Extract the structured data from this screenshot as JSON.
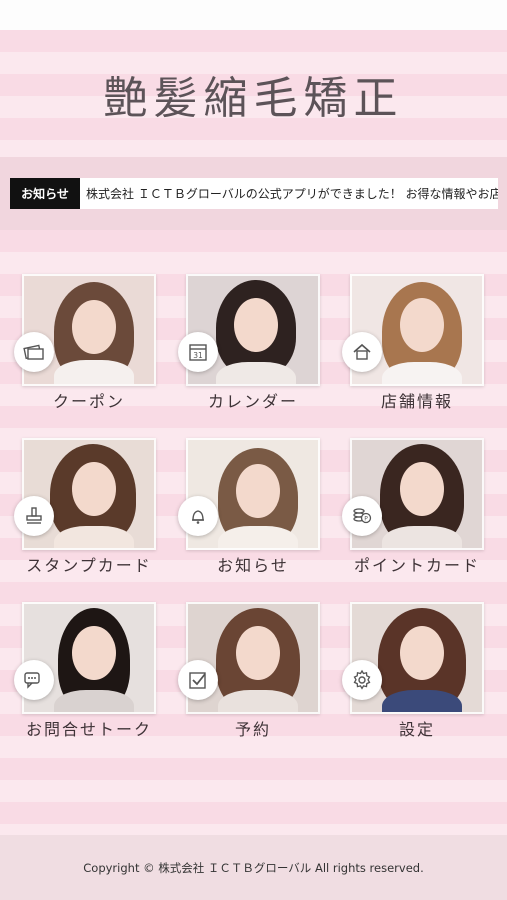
{
  "header": {
    "title": "艶髪縮毛矯正"
  },
  "news": {
    "label": "お知らせ",
    "text": "株式会社 ＩＣＴＢグローバルの公式アプリができました！ お得な情報やお店"
  },
  "menu": [
    {
      "label": "クーポン",
      "icon": "coupon-icon"
    },
    {
      "label": "カレンダー",
      "icon": "calendar-icon",
      "calendar_day": "31"
    },
    {
      "label": "店舗情報",
      "icon": "home-icon"
    },
    {
      "label": "スタンプカード",
      "icon": "stamp-icon"
    },
    {
      "label": "お知らせ",
      "icon": "bell-icon"
    },
    {
      "label": "ポイントカード",
      "icon": "coins-icon"
    },
    {
      "label": "お問合せトーク",
      "icon": "chat-icon"
    },
    {
      "label": "予約",
      "icon": "checkbox-icon"
    },
    {
      "label": "設定",
      "icon": "gear-icon"
    }
  ],
  "footer": {
    "copyright": "Copyright © 株式会社 ＩＣＴＢグローバル All rights reserved."
  },
  "colors": {
    "stripe_light": "#fbe8ee",
    "stripe_dark": "#f9dbe5",
    "news_label_bg": "#111111",
    "text": "#3e3337"
  }
}
